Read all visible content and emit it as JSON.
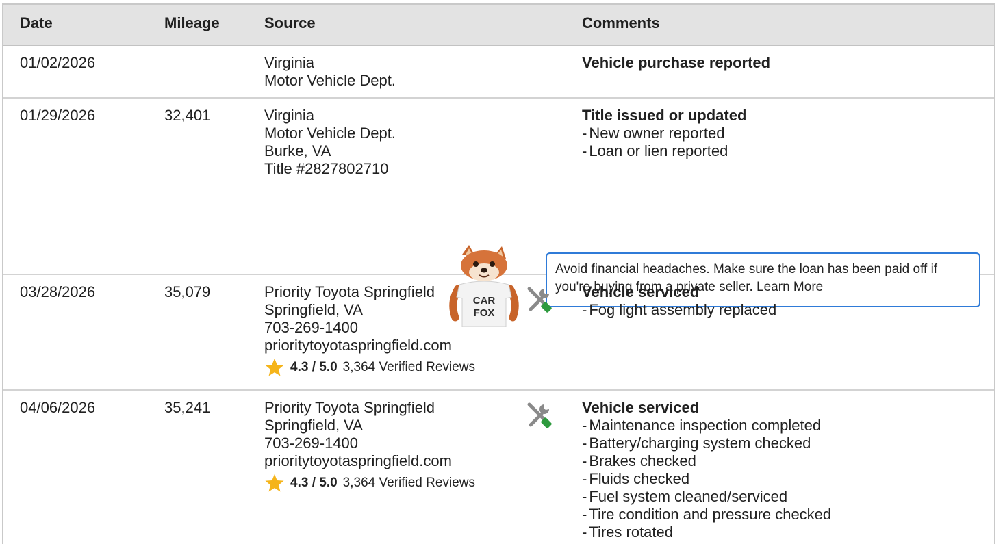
{
  "header": {
    "date": "Date",
    "mileage": "Mileage",
    "source": "Source",
    "comments": "Comments"
  },
  "rows": [
    {
      "date": "01/02/2026",
      "mileage": "",
      "source": [
        "Virginia",
        "Motor Vehicle Dept."
      ],
      "comment_title": "Vehicle purchase reported",
      "comment_items": []
    },
    {
      "date": "01/29/2026",
      "mileage": "32,401",
      "source": [
        "Virginia",
        "Motor Vehicle Dept.",
        "Burke, VA",
        "Title #2827802710"
      ],
      "comment_title": "Title issued or updated",
      "comment_items": [
        "New owner reported",
        "Loan or lien reported"
      ],
      "tip": "Avoid financial headaches. Make sure the loan has been paid off if you're buying from a private seller. Learn More",
      "mascot_text": [
        "CAR",
        "FOX"
      ]
    },
    {
      "date": "03/28/2026",
      "mileage": "35,079",
      "source": [
        "Priority Toyota Springfield",
        "Springfield, VA",
        "703-269-1400",
        "prioritytoyotaspringfield.com"
      ],
      "rating": "4.3 / 5.0",
      "reviews": "3,364 Verified Reviews",
      "icon": "service-tools-icon",
      "comment_title": "Vehicle serviced",
      "comment_items": [
        "Fog light assembly replaced"
      ]
    },
    {
      "date": "04/06/2026",
      "mileage": "35,241",
      "source": [
        "Priority Toyota Springfield",
        "Springfield, VA",
        "703-269-1400",
        "prioritytoyotaspringfield.com"
      ],
      "rating": "4.3 / 5.0",
      "reviews": "3,364 Verified Reviews",
      "icon": "service-tools-icon",
      "comment_title": "Vehicle serviced",
      "comment_items": [
        "Maintenance inspection completed",
        "Battery/charging system checked",
        "Brakes checked",
        "Fluids checked",
        "Fuel system cleaned/serviced",
        "Tire condition and pressure checked",
        "Tires rotated"
      ]
    }
  ],
  "colors": {
    "header_bg": "#e3e3e3",
    "tip_border": "#2f7bd8",
    "star": "#f5b41a",
    "wrench_green": "#2e9a3e"
  }
}
